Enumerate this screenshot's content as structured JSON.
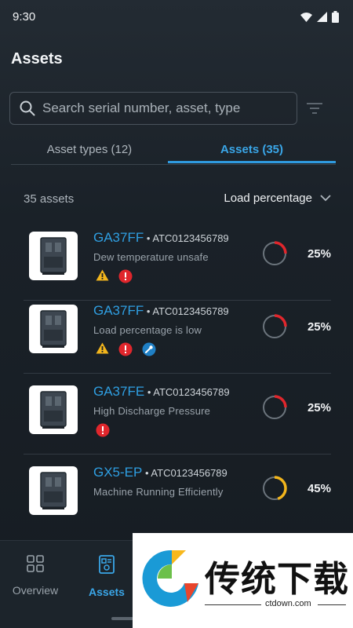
{
  "status_bar": {
    "time": "9:30"
  },
  "page": {
    "title": "Assets"
  },
  "search": {
    "placeholder": "Search serial number, asset, type"
  },
  "tabs": [
    {
      "label": "Asset types (12)",
      "active": false
    },
    {
      "label": "Assets (35)",
      "active": true
    }
  ],
  "list": {
    "count_label": "35 assets",
    "sort_label": "Load percentage"
  },
  "assets": [
    {
      "name": "GA37FF",
      "serial": "ATC0123456789",
      "status": "Dew temperature unsafe",
      "alerts": [
        "warning",
        "error"
      ],
      "load_percent": 25,
      "load_label": "25%",
      "gauge_color": "#e0262c"
    },
    {
      "name": "GA37FF",
      "serial": "ATC0123456789",
      "status": "Load percentage is low",
      "alerts": [
        "warning",
        "error",
        "service"
      ],
      "load_percent": 25,
      "load_label": "25%",
      "gauge_color": "#e0262c"
    },
    {
      "name": "GA37FE",
      "serial": "ATC0123456789",
      "status": "High Discharge Pressure",
      "alerts": [
        "error"
      ],
      "load_percent": 25,
      "load_label": "25%",
      "gauge_color": "#e0262c"
    },
    {
      "name": "GX5-EP",
      "serial": "ATC0123456789",
      "status": "Machine Running Efficiently",
      "alerts": [],
      "load_percent": 45,
      "load_label": "45%",
      "gauge_color": "#f2b51c"
    }
  ],
  "bottom_nav": [
    {
      "label": "Overview",
      "icon": "grid-icon",
      "active": false
    },
    {
      "label": "Assets",
      "icon": "assets-icon",
      "active": true
    }
  ],
  "watermark": {
    "text": "传统下载",
    "url": "ctdown.com"
  },
  "colors": {
    "accent": "#2f9be0",
    "error": "#e0262c",
    "warning": "#f2b51c",
    "service": "#1f7fc4"
  }
}
